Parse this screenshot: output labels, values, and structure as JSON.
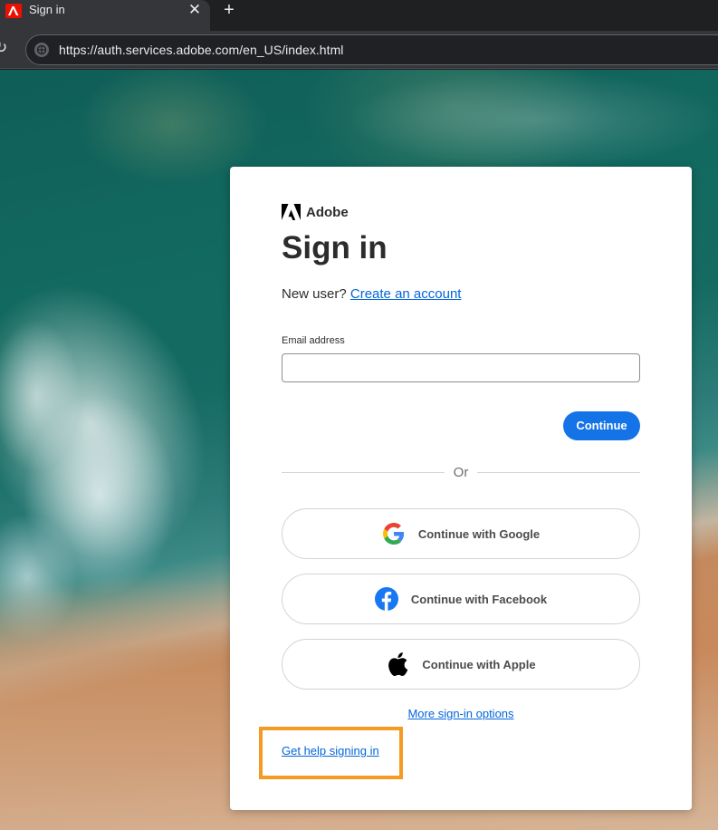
{
  "browser": {
    "tab": {
      "title": "Sign in",
      "close_glyph": "✕",
      "favicon_icon": "adobe-favicon-icon"
    },
    "new_tab_glyph": "+",
    "reload_glyph": "↻",
    "url": "https://auth.services.adobe.com/en_US/index.html"
  },
  "signin": {
    "brand_name": "Adobe",
    "heading": "Sign in",
    "new_user_text": "New user?",
    "create_account_link": "Create an account",
    "email_label": "Email address",
    "email_value": "",
    "continue_label": "Continue",
    "or_text": "Or",
    "social": [
      {
        "label": "Continue with Google",
        "icon": "google-icon"
      },
      {
        "label": "Continue with Facebook",
        "icon": "facebook-icon"
      },
      {
        "label": "Continue with Apple",
        "icon": "apple-icon"
      }
    ],
    "more_options_link": "More sign-in options",
    "help_link": "Get help signing in"
  },
  "colors": {
    "accent": "#1473e6",
    "link": "#0265dc",
    "highlight": "#f59a23"
  }
}
